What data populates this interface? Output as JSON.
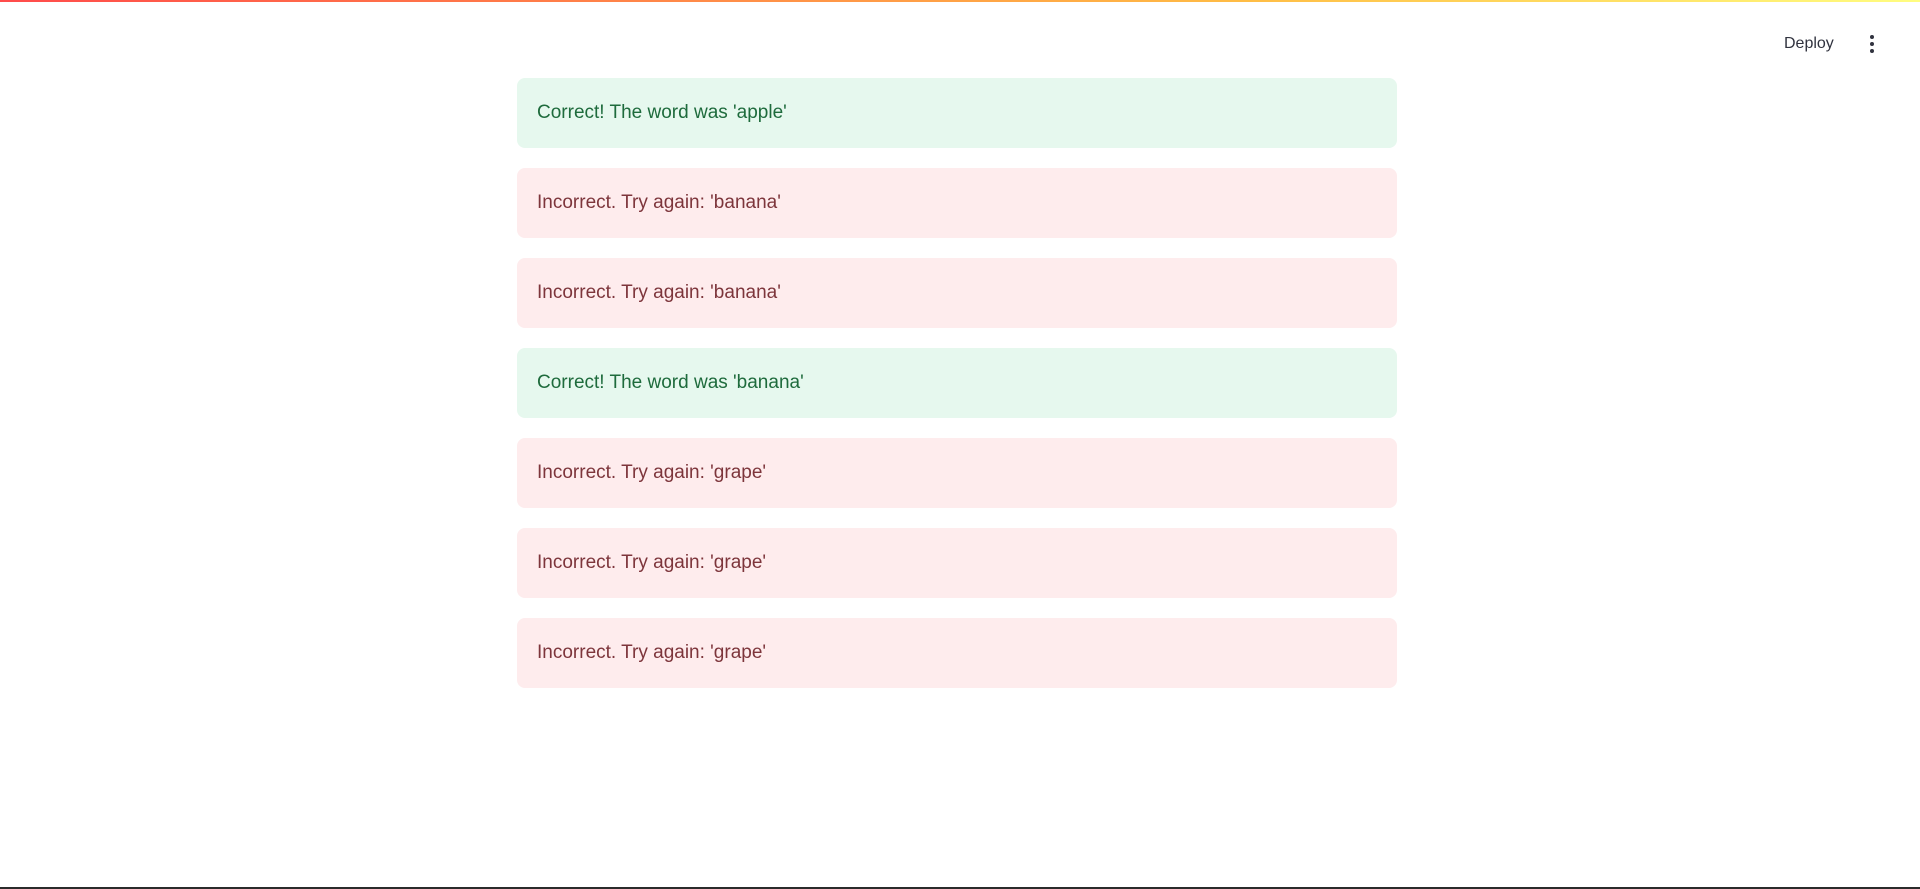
{
  "header": {
    "deploy_label": "Deploy",
    "menu_icon": "vertical-ellipsis-icon"
  },
  "colors": {
    "success_bg": "#e6f8ee",
    "success_text": "#1e6b3c",
    "error_bg": "#feeced",
    "error_text": "#7d353b",
    "accent_gradient": [
      "#ff4b4b",
      "#ffbd45",
      "#fffd80"
    ]
  },
  "messages": [
    {
      "type": "success",
      "text": "Correct! The word was 'apple'"
    },
    {
      "type": "error",
      "text": "Incorrect. Try again: 'banana'"
    },
    {
      "type": "error",
      "text": "Incorrect. Try again: 'banana'"
    },
    {
      "type": "success",
      "text": "Correct! The word was 'banana'"
    },
    {
      "type": "error",
      "text": "Incorrect. Try again: 'grape'"
    },
    {
      "type": "error",
      "text": "Incorrect. Try again: 'grape'"
    },
    {
      "type": "error",
      "text": "Incorrect. Try again: 'grape'"
    }
  ]
}
